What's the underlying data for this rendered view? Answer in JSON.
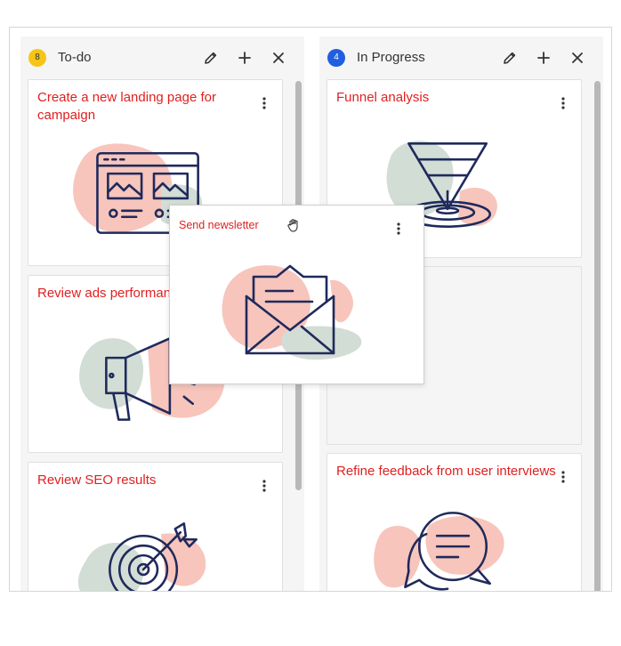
{
  "columns": [
    {
      "title": "To-do",
      "count": "8",
      "badge_color": "#f5c518",
      "cards": [
        {
          "title": "Create a new landing page for campaign",
          "illustration": "landing-page-illustration"
        },
        {
          "title": "Review ads performance",
          "illustration": "megaphone-illustration"
        },
        {
          "title": "Review SEO results",
          "illustration": "target-illustration"
        }
      ]
    },
    {
      "title": "In Progress",
      "count": "4",
      "badge_color": "#1f5fe0",
      "cards": [
        {
          "title": "Funnel analysis",
          "illustration": "funnel-illustration"
        },
        {
          "title": "",
          "illustration": "drop-placeholder"
        },
        {
          "title": "Refine feedback from user interviews",
          "illustration": "chat-bubbles-illustration"
        }
      ]
    }
  ],
  "dragging_card": {
    "title": "Send newsletter",
    "illustration": "envelope-illustration"
  },
  "icons": {
    "edit": "pencil-icon",
    "add": "plus-icon",
    "close": "close-icon",
    "menu": "kebab-menu-icon",
    "cursor": "grab-hand-icon"
  },
  "colors": {
    "card_title": "#e02020",
    "illustration_stroke": "#1f2a5c",
    "blob_pink": "#f7c5bb",
    "blob_green": "#d2ddd5"
  }
}
